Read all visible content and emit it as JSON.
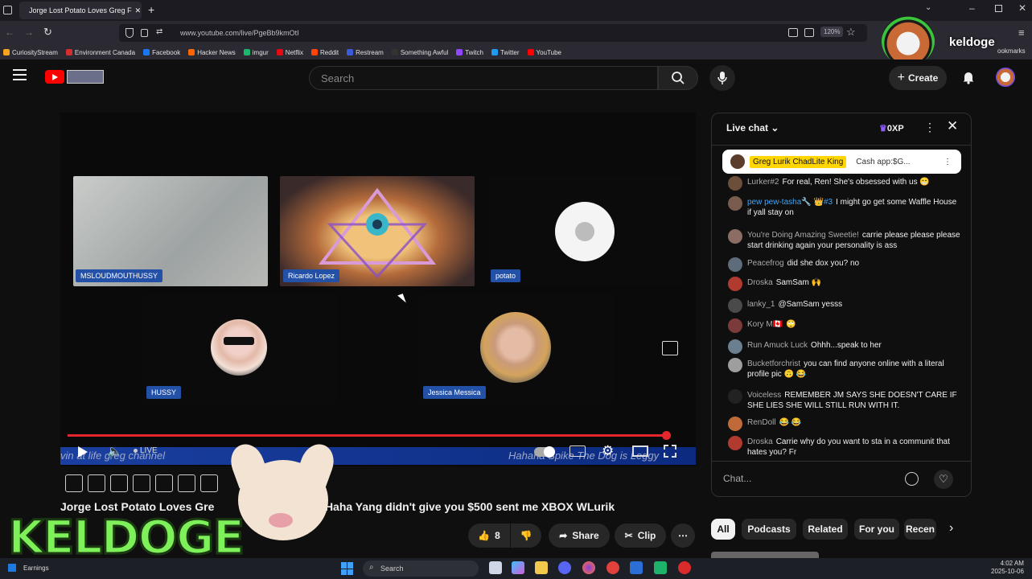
{
  "browser": {
    "tab_title": "Jorge Lost Potato Loves Greg F",
    "url": "www.youtube.com/live/PgeBb9kmOtI",
    "zoom": "120%",
    "bookmarks": [
      {
        "label": "CuriosityStream",
        "color": "#f6a21c"
      },
      {
        "label": "Environment Canada",
        "color": "#d32f2f"
      },
      {
        "label": "Facebook",
        "color": "#1877f2"
      },
      {
        "label": "Hacker News",
        "color": "#ff6600"
      },
      {
        "label": "imgur",
        "color": "#1bb76e"
      },
      {
        "label": "Netflix",
        "color": "#e50914"
      },
      {
        "label": "Reddit",
        "color": "#ff4500"
      },
      {
        "label": "Restream",
        "color": "#3b5bdb"
      },
      {
        "label": "Something Awful",
        "color": "#333333"
      },
      {
        "label": "Twitch",
        "color": "#9146ff"
      },
      {
        "label": "Twitter",
        "color": "#1d9bf0"
      },
      {
        "label": "YouTube",
        "color": "#ff0000"
      }
    ],
    "bookmarks_overflow": "ookmarks",
    "profile_name": "keldoge"
  },
  "header": {
    "search_placeholder": "Search",
    "create_label": "Create"
  },
  "player": {
    "participants": [
      {
        "name": "MSLOUDMOUTHUSSY"
      },
      {
        "name": "Ricardo Lopez"
      },
      {
        "name": "potato"
      },
      {
        "name": "HUSSY"
      },
      {
        "name": "Jessica Messica"
      }
    ],
    "live_label": "LIVE",
    "ticker_left": "vin at life greg channel",
    "ticker_right": "Hahaha Spike The Dog is Leggy",
    "progress": 0.96
  },
  "video": {
    "title": "Jorge Lost Potato Loves Gre",
    "title_rest": "le Haha Yang didn't give you $500 sent me XBOX WLurik",
    "like_count": "8",
    "share_label": "Share",
    "clip_label": "Clip"
  },
  "overlay": {
    "streamer_name": "KELDOGE"
  },
  "chat": {
    "title": "Live chat",
    "xp": "0XP",
    "pinned_author": "Greg Lurik ChadLite King",
    "pinned_text": "Cash app:$G...",
    "messages": [
      {
        "author": "Lurker#2",
        "text": "For real, Ren! She's obsessed with us 😁",
        "color": "#6b4f3a"
      },
      {
        "author": "pew pew-tasha🔧 👑#3",
        "text": "I might go get some Waffle House if yall stay on",
        "color": "#7a5c4f",
        "highlight": true
      },
      {
        "author": "You're Doing Amazing Sweetie!",
        "text": "carrie please please please start drinking again your personality is ass",
        "color": "#8c6d63"
      },
      {
        "author": "Peacefrog",
        "text": "did she dox you? no",
        "color": "#5d6b7a"
      },
      {
        "author": "Droska",
        "text": "SamSam 🙌",
        "color": "#b03a2e"
      },
      {
        "author": "lanky_1",
        "text": "@SamSam yesss",
        "color": "#4a4a4a"
      },
      {
        "author": "Kory M🇨🇦",
        "text": "🙄",
        "color": "#7b3b3b"
      },
      {
        "author": "Run Amuck Luck",
        "text": "Ohhh...speak to her",
        "color": "#6a7f8f"
      },
      {
        "author": "Bucketforchrist",
        "text": "you can find anyone online with a literal profile pic 🙃 😂",
        "color": "#9e9e9e"
      },
      {
        "author": "Voiceless",
        "text": "REMEMBER JM SAYS SHE DOESN'T CARE IF SHE LIES SHE WILL STILL RUN WITH IT.",
        "color": "#222222"
      },
      {
        "author": "RenDoll",
        "text": "😂 😂",
        "color": "#c06a3a"
      },
      {
        "author": "Droska",
        "text": "Carrie why do you want to sta in a communit that hates you? Fr",
        "color": "#b03a2e"
      }
    ],
    "input_placeholder": "Chat..."
  },
  "chips": [
    "All",
    "Podcasts",
    "Related",
    "For you",
    "Recen"
  ],
  "taskbar": {
    "earnings_label": "Earnings",
    "search_label": "Search",
    "time": "4:02 AM",
    "date": "2025-10-06"
  }
}
